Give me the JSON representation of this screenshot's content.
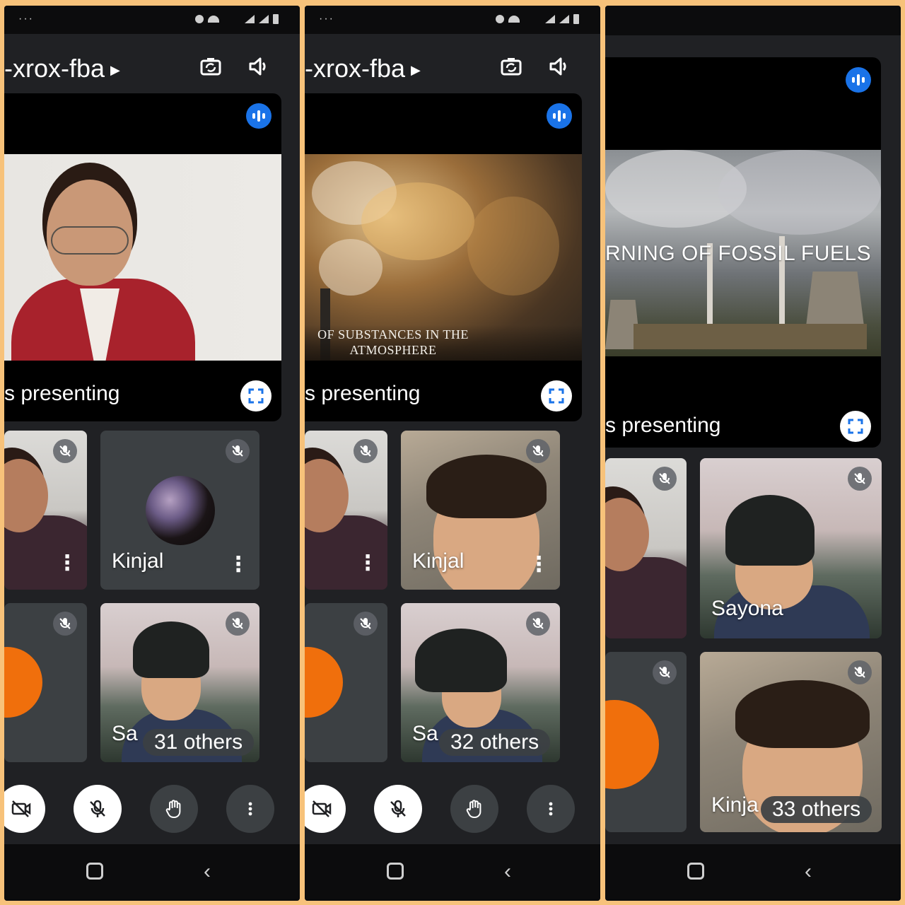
{
  "colors": {
    "frame": "#f7c27a",
    "panel": "#202124",
    "accent": "#1a73e8",
    "orange": "#f06f0c",
    "tile": "#3c4043"
  },
  "phones": [
    {
      "status_icons": [
        "overflow-dots",
        "alarm-icon",
        "wifi-icon",
        "volte-icon",
        "signal-icon",
        "battery-icon"
      ],
      "status_dots": "···",
      "meeting_code": "-xrox-fba",
      "presenting_label": "s presenting",
      "screen_caption": "",
      "tiles": {
        "kinjal_name": "Kinjal",
        "sayona_name": "Sa",
        "others_label": "31 others"
      }
    },
    {
      "status_dots": "···",
      "meeting_code": "-xrox-fba",
      "presenting_label": "s presenting",
      "screen_caption": "OF SUBSTANCES IN THE ATMOSPHERE",
      "tiles": {
        "kinjal_name": "Kinjal",
        "sayona_name": "Sa",
        "others_label": "32 others"
      }
    },
    {
      "presenting_label": "s presenting",
      "screen_title": "RNING OF FOSSIL FUELS",
      "tiles": {
        "sayona_name": "Sayona",
        "kinjal_name": "Kinja",
        "others_label": "33 others"
      }
    }
  ],
  "controls": [
    "camera-off",
    "mic-off",
    "raise-hand",
    "more-options"
  ],
  "nav": [
    "home",
    "back"
  ]
}
